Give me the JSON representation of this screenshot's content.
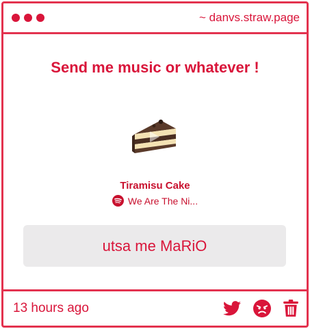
{
  "titlebar": {
    "site": "~ danvs.straw.page"
  },
  "prompt": "Send me music or whatever !",
  "track": {
    "title": "Tiramisu Cake",
    "artist": "We Are The Ni...",
    "artwork_icon": "cake-slice-artwork",
    "service_icon": "spotify-icon"
  },
  "message": "utsa me MaRiO",
  "footer": {
    "time": "13 hours ago",
    "icons": [
      "twitter-icon",
      "angry-face-icon",
      "trash-icon"
    ]
  },
  "colors": {
    "accent": "#d9153a",
    "border": "#e3334f",
    "message_bg": "#ebeaeb"
  }
}
